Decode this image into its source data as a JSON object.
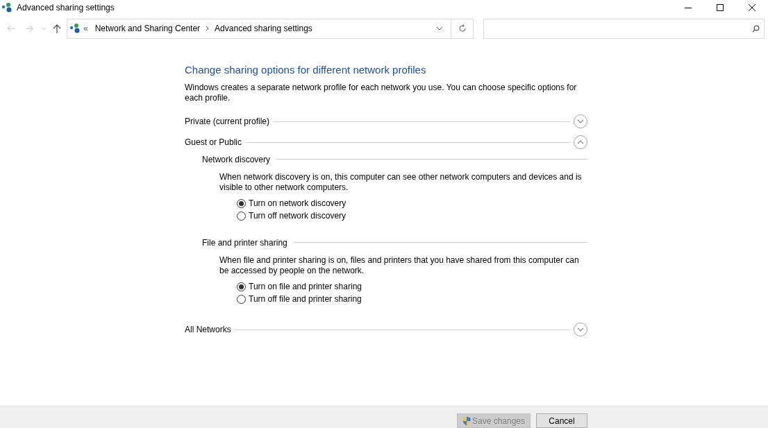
{
  "window": {
    "title": "Advanced sharing settings"
  },
  "address": {
    "overflow": "«",
    "crumbs": [
      "Network and Sharing Center",
      "Advanced sharing settings"
    ]
  },
  "heading": "Change sharing options for different network profiles",
  "intro": "Windows creates a separate network profile for each network you use. You can choose specific options for each profile.",
  "profiles": [
    {
      "label": "Private (current profile)",
      "expanded": false
    },
    {
      "label": "Guest or Public",
      "expanded": true,
      "sections": [
        {
          "title": "Network discovery",
          "description": "When network discovery is on, this computer can see other network computers and devices and is visible to other network computers.",
          "options": [
            {
              "label": "Turn on network discovery",
              "selected": true
            },
            {
              "label": "Turn off network discovery",
              "selected": false
            }
          ]
        },
        {
          "title": "File and printer sharing",
          "description": "When file and printer sharing is on, files and printers that you have shared from this computer can be accessed by people on the network.",
          "options": [
            {
              "label": "Turn on file and printer sharing",
              "selected": true
            },
            {
              "label": "Turn off file and printer sharing",
              "selected": false
            }
          ]
        }
      ]
    },
    {
      "label": "All Networks",
      "expanded": false
    }
  ],
  "footer": {
    "buttons": [
      {
        "label": "Save changes",
        "kind": "shield",
        "disabled": true
      },
      {
        "label": "Cancel",
        "kind": "plain",
        "disabled": false
      }
    ]
  }
}
